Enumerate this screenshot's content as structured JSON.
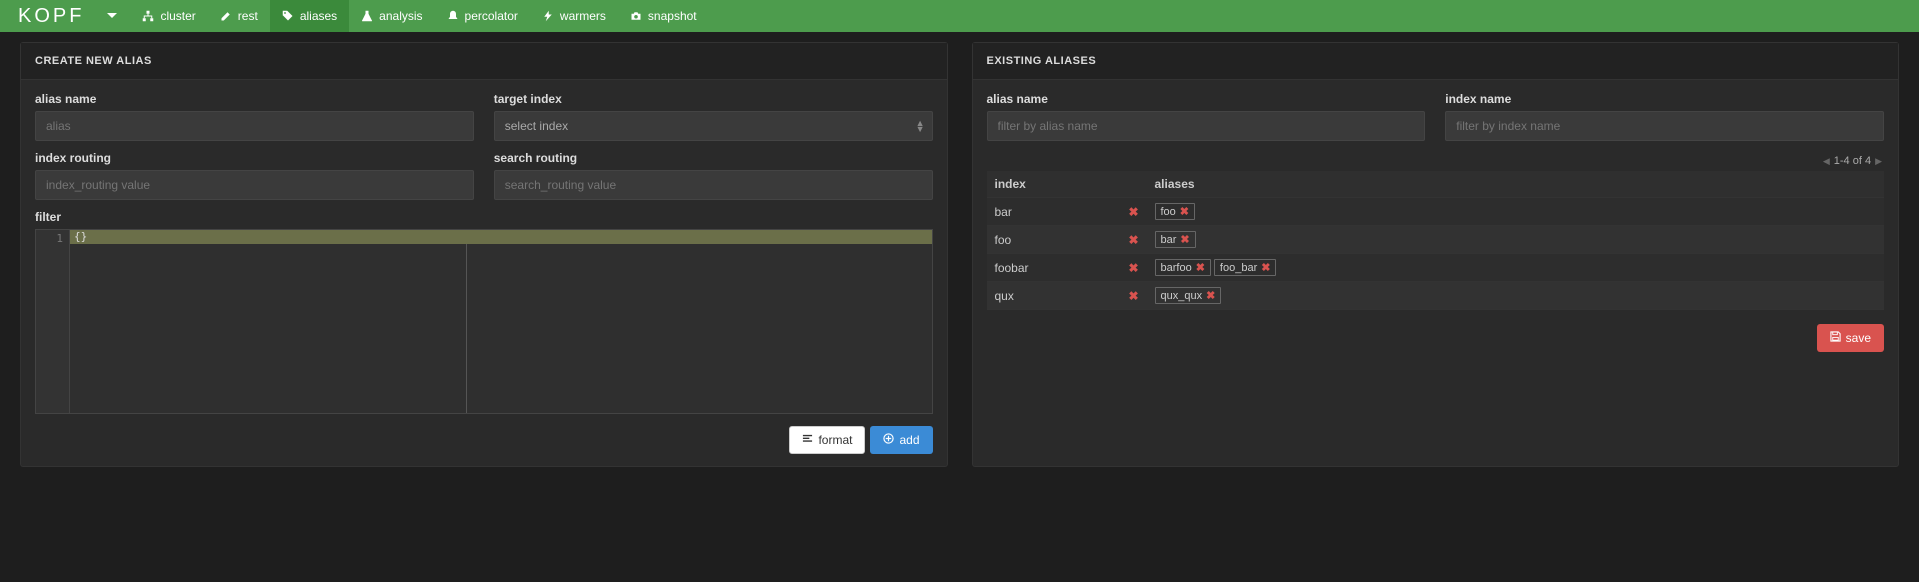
{
  "brand": "KOPF",
  "nav": [
    {
      "id": "cluster",
      "label": "cluster",
      "active": false
    },
    {
      "id": "rest",
      "label": "rest",
      "active": false
    },
    {
      "id": "aliases",
      "label": "aliases",
      "active": true
    },
    {
      "id": "analysis",
      "label": "analysis",
      "active": false
    },
    {
      "id": "percolator",
      "label": "percolator",
      "active": false
    },
    {
      "id": "warmers",
      "label": "warmers",
      "active": false
    },
    {
      "id": "snapshot",
      "label": "snapshot",
      "active": false
    }
  ],
  "create": {
    "title": "CREATE NEW ALIAS",
    "alias_label": "alias name",
    "alias_placeholder": "alias",
    "target_label": "target index",
    "target_placeholder": "select index",
    "index_routing_label": "index routing",
    "index_routing_placeholder": "index_routing value",
    "search_routing_label": "search routing",
    "search_routing_placeholder": "search_routing value",
    "filter_label": "filter",
    "filter_value": "{}",
    "gutter_line": "1",
    "format_label": "format",
    "add_label": "add"
  },
  "existing": {
    "title": "EXISTING ALIASES",
    "alias_filter_label": "alias name",
    "alias_filter_placeholder": "filter by alias name",
    "index_filter_label": "index name",
    "index_filter_placeholder": "filter by index name",
    "col_index": "index",
    "col_aliases": "aliases",
    "pager": "1-4 of 4",
    "rows": [
      {
        "index": "bar",
        "aliases": [
          "foo"
        ]
      },
      {
        "index": "foo",
        "aliases": [
          "bar"
        ]
      },
      {
        "index": "foobar",
        "aliases": [
          "barfoo",
          "foo_bar"
        ]
      },
      {
        "index": "qux",
        "aliases": [
          "qux_qux"
        ]
      }
    ],
    "save_label": "save"
  }
}
